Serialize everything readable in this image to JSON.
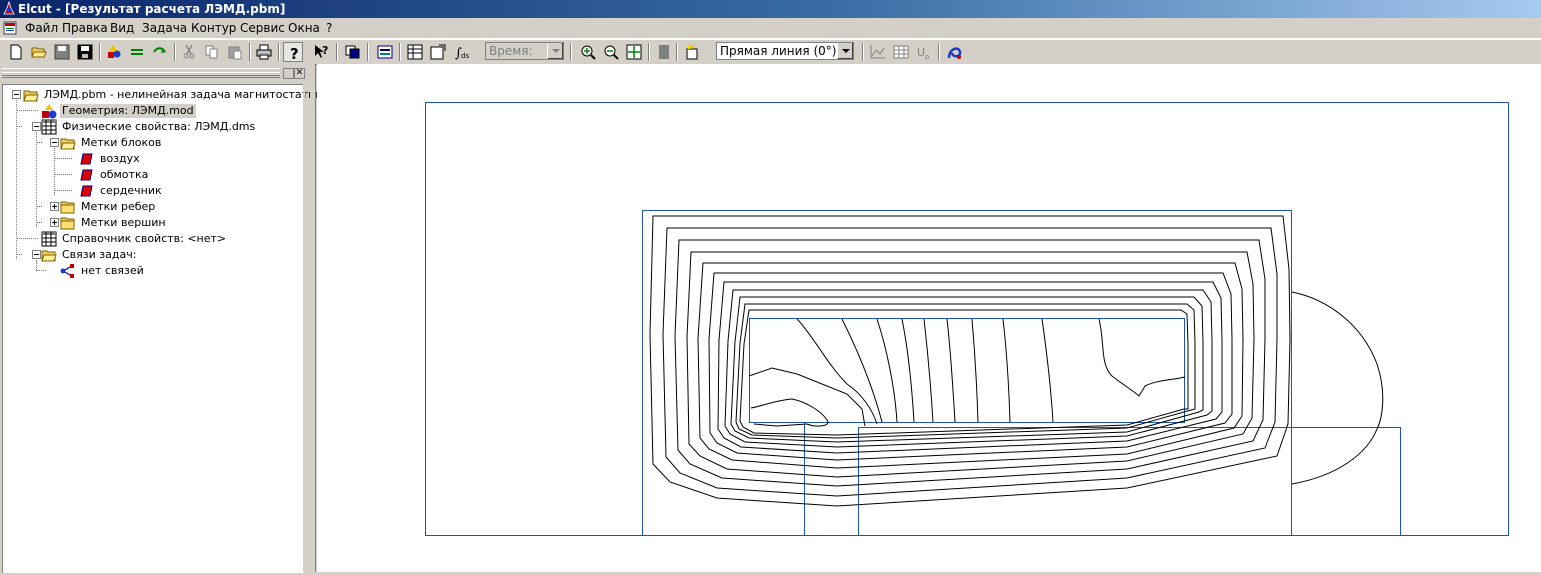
{
  "window": {
    "title": "Elcut - [Результат расчета ЛЭМД.pbm]"
  },
  "menu": [
    "Файл",
    "Правка",
    "Вид",
    "Задача",
    "Контур",
    "Сервис",
    "Окна",
    "?"
  ],
  "toolbar": {
    "time_combo": "Время:",
    "line_combo": "Прямая линия (0°)"
  },
  "tree": {
    "root": "ЛЭМД.pbm - нелинейная задача магнитостатики",
    "geometry": "Геометрия: ЛЭМД.mod",
    "physics": "Физические свойства: ЛЭМД.dms",
    "block_labels": "Метки блоков",
    "blocks": [
      "воздух",
      "обмотка",
      "сердечник"
    ],
    "edge_labels": "Метки ребер",
    "vertex_labels": "Метки вершин",
    "library": "Справочник свойств: <нет>",
    "links": "Связи задач:",
    "no_links": "нет связей"
  },
  "colors": {
    "model_outline": "#1a56b0",
    "contour": "#000000",
    "title_start": "#0a246a",
    "title_end": "#a6caf0"
  }
}
